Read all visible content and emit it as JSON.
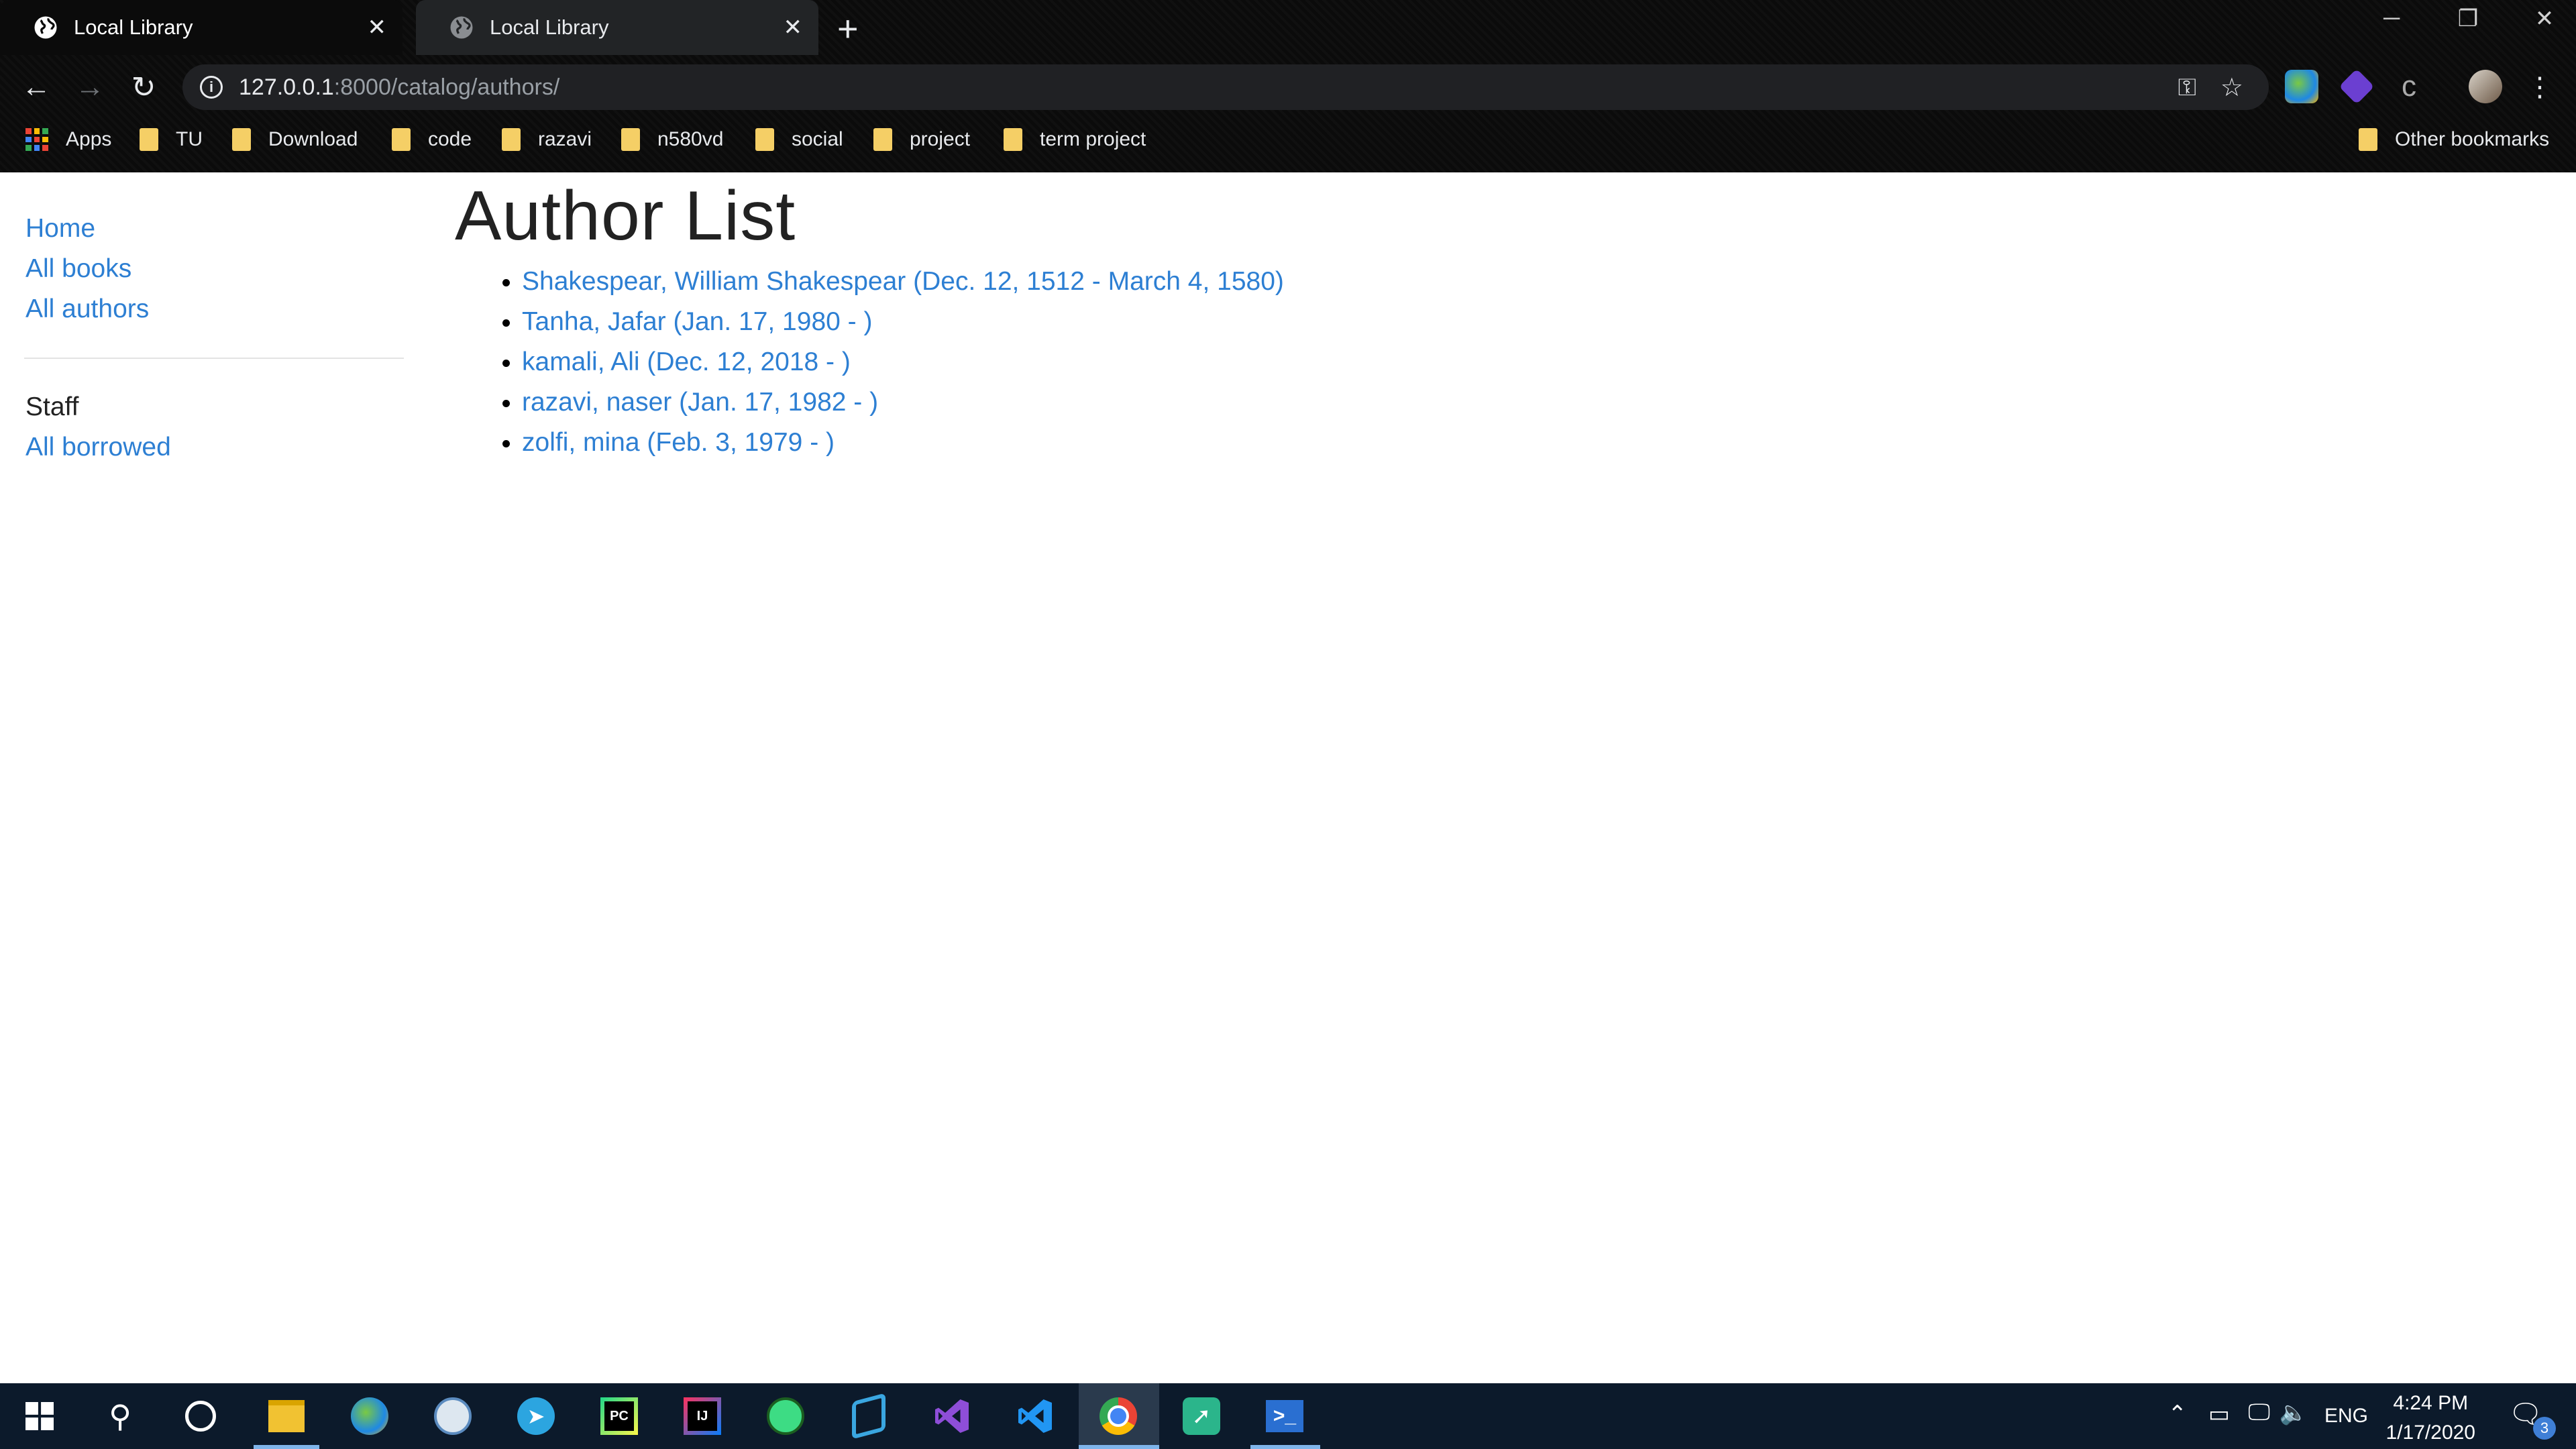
{
  "browser": {
    "tabs": [
      {
        "title": "Local Library",
        "active": true
      },
      {
        "title": "Local Library",
        "active": false
      }
    ],
    "address": {
      "host": "127.0.0.1",
      "path": ":8000/catalog/authors/"
    },
    "bookmarks": [
      "Apps",
      "TU",
      "Download",
      "code",
      "razavi",
      "n580vd",
      "social",
      "project",
      "term project"
    ],
    "other_bookmarks": "Other bookmarks"
  },
  "sidebar": {
    "links": [
      "Home",
      "All books",
      "All authors"
    ],
    "staff_heading": "Staff",
    "staff_links": [
      "All borrowed"
    ]
  },
  "main": {
    "title": "Author List",
    "authors": [
      "Shakespear, William Shakespear (Dec. 12, 1512 - March 4, 1580)",
      "Tanha, Jafar (Jan. 17, 1980 - )",
      "kamali, Ali (Dec. 12, 2018 - )",
      "razavi, naser (Jan. 17, 1982 - )",
      "zolfi, mina (Feb. 3, 1979 - )"
    ]
  },
  "taskbar": {
    "language": "ENG",
    "time": "4:24 PM",
    "date": "1/17/2020",
    "notification_count": "3"
  },
  "colors": {
    "link": "#2d7fd3",
    "taskbar": "#0c1a2b",
    "chrome": "#0b0b0b"
  }
}
